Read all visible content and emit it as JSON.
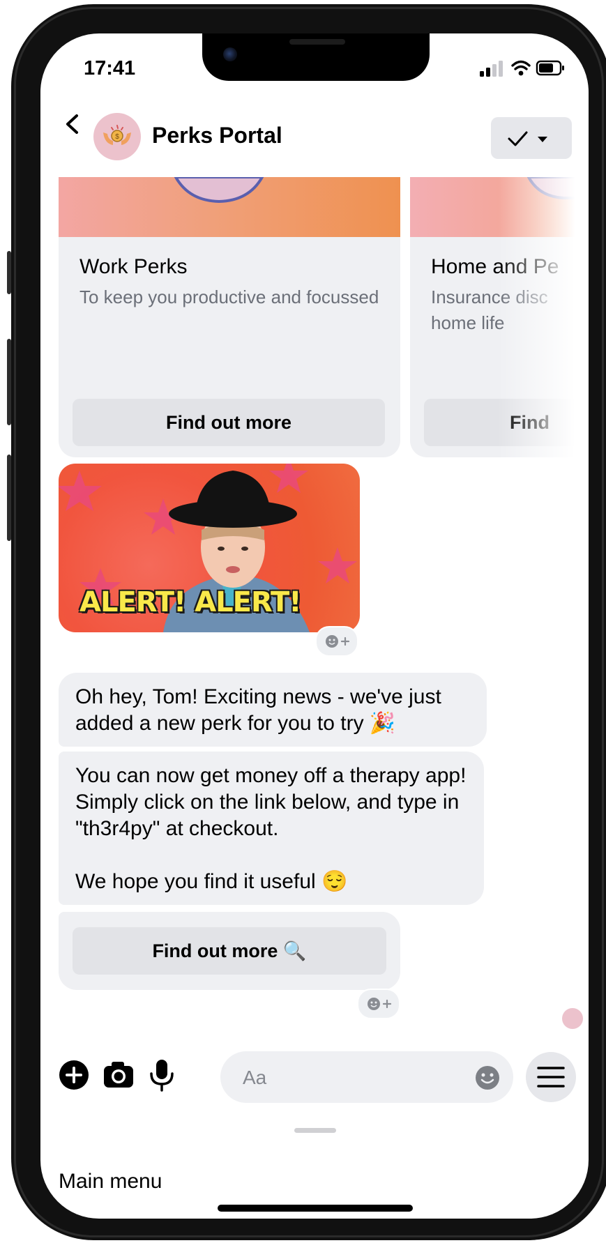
{
  "status_bar": {
    "time": "17:41"
  },
  "header": {
    "title": "Perks Portal"
  },
  "carousel": [
    {
      "title": "Work Perks",
      "subtitle": "To keep you productive and focussed",
      "button": "Find out more"
    },
    {
      "title": "Home and Pe",
      "subtitle": "Insurance disc home life",
      "button": "Find"
    }
  ],
  "gif": {
    "caption": "ALERT! ALERT!"
  },
  "messages": [
    "Oh hey, Tom! Exciting news - we've just added a new perk for you to try 🎉",
    "You can now get money off a therapy app! Simply click on the link below, and type in \"th3r4py\" at checkout.\n\nWe hope you find it useful 😌"
  ],
  "link_button": {
    "label": "Find out more 🔍"
  },
  "composer": {
    "placeholder": "Aa"
  },
  "footer": {
    "main_menu": "Main menu"
  },
  "colors": {
    "bubble": "#eff0f3",
    "banner_start": "#f3a6a3",
    "banner_end": "#ef9150",
    "gif_caption": "#f9e84a"
  },
  "icons": [
    "back-icon",
    "checkmark-icon",
    "caret-down-icon",
    "plus-icon",
    "camera-icon",
    "microphone-icon",
    "emoji-icon",
    "menu-icon",
    "add-reaction-icon"
  ]
}
